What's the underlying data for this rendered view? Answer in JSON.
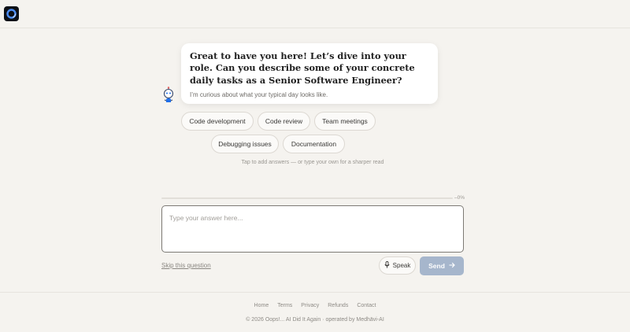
{
  "header": {
    "logo_icon": "circular-o-logo-icon"
  },
  "question": {
    "text": "Great to have you here! Let’s dive into your role. Can you describe some of your concrete daily tasks as a Senior Software Engineer?",
    "subtext": "I’m curious about what your typical day looks like.",
    "avatar_icon": "robot-avatar-icon"
  },
  "suggestions": [
    {
      "label": "Code development"
    },
    {
      "label": "Code review"
    },
    {
      "label": "Team meetings"
    },
    {
      "label": "Debugging issues"
    },
    {
      "label": "Documentation"
    }
  ],
  "hint": "Tap to add answers — or type your own for a sharper read",
  "progress": {
    "value_percent": 0,
    "label": "0%"
  },
  "answer": {
    "placeholder": "Type your answer here...",
    "value": ""
  },
  "actions": {
    "skip_label": "Skip this question",
    "speak_label": "Speak",
    "speak_icon": "microphone-icon",
    "send_label": "Send",
    "send_icon": "arrow-right-icon"
  },
  "footer": {
    "links": [
      "Home",
      "Terms",
      "Privacy",
      "Refunds",
      "Contact"
    ],
    "copyright": "© 2026 Oops!... AI Did It Again · operated by Medhāvi-AI"
  },
  "colors": {
    "background": "#f5f3ef",
    "send_button": "#a6b6cc",
    "progress_fill": "#1f6feb"
  }
}
